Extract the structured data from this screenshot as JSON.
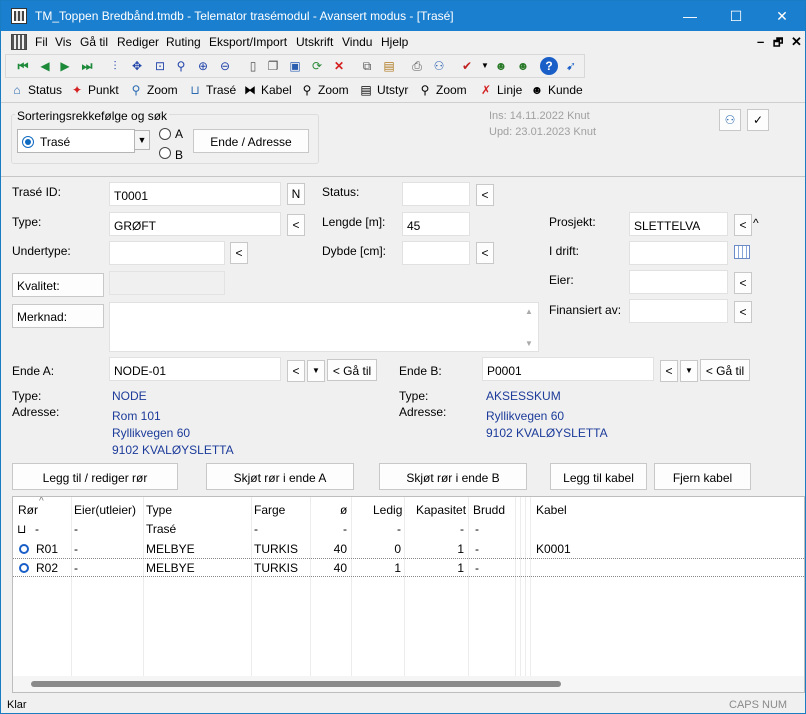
{
  "window": {
    "title": "TM_Toppen Bredbånd.tmdb - Telemator trasémodul - Avansert modus - [Trasé]",
    "min": "—",
    "max": "☐",
    "close": "✕"
  },
  "menu": [
    "Fil",
    "Vis",
    "Gå til",
    "Rediger",
    "Ruting",
    "Eksport/Import",
    "Utskrift",
    "Vindu",
    "Hjelp"
  ],
  "mdi_controls": {
    "min": "–",
    "restore": "🗗",
    "close": "✕"
  },
  "toolbar_icons": [
    "first-record-icon",
    "prev-record-icon",
    "next-record-icon",
    "last-record-icon",
    "route-icon",
    "move-icon",
    "zoom-extent-icon",
    "search-icon",
    "zoom-in-icon",
    "zoom-out-icon",
    "new-icon",
    "copy-icon",
    "save-icon",
    "refresh-icon",
    "delete-icon",
    "copy-record-icon",
    "paste-icon",
    "print-icon",
    "network-icon",
    "map-icon",
    "user-icon",
    "user2-icon",
    "help-icon",
    "context-help-icon"
  ],
  "nav": {
    "status": "Status",
    "punkt": "Punkt",
    "zoom1": "Zoom",
    "trase": "Trasé",
    "kabel": "Kabel",
    "zoom2": "Zoom",
    "utstyr": "Utstyr",
    "zoom3": "Zoom",
    "linje": "Linje",
    "kunde": "Kunde"
  },
  "sort": {
    "group_label": "Sorteringsrekkefølge og søk",
    "selected": "Trasé",
    "radio_a": "A",
    "radio_b": "B",
    "ende_button": "Ende / Adresse"
  },
  "meta": {
    "ins": "Ins: 14.11.2022 Knut",
    "upd": "Upd: 23.01.2023 Knut"
  },
  "form": {
    "trase_id_label": "Trasé ID:",
    "trase_id": "T0001",
    "n_button": "N",
    "type_label": "Type:",
    "type": "GRØFT",
    "undertype_label": "Undertype:",
    "undertype": "",
    "kvalitet_button": "Kvalitet:",
    "kvalitet": "",
    "merknad_button": "Merknad:",
    "merknad": "",
    "status_label": "Status:",
    "status": "",
    "lengde_label": "Lengde [m]:",
    "lengde": "45",
    "dybde_label": "Dybde [cm]:",
    "dybde": "",
    "prosjekt_label": "Prosjekt:",
    "prosjekt": "SLETTELVA",
    "idrift_label": "I drift:",
    "idrift": "",
    "eier_label": "Eier:",
    "eier": "",
    "finansiert_label": "Finansiert av:",
    "finansiert": "",
    "back": "<",
    "up": "^",
    "dropdown": "▼"
  },
  "ende_a": {
    "label": "Ende A:",
    "value": "NODE-01",
    "goto": "< Gå til",
    "type_label": "Type:",
    "type": "NODE",
    "adresse_label": "Adresse:",
    "address_lines": [
      "Rom 101",
      "Ryllikvegen 60",
      "9102 KVALØYSLETTA"
    ]
  },
  "ende_b": {
    "label": "Ende B:",
    "value": "P0001",
    "goto": "< Gå til",
    "type_label": "Type:",
    "type": "AKSESSKUM",
    "adresse_label": "Adresse:",
    "address_lines": [
      "Ryllikvegen 60",
      "9102 KVALØYSLETTA"
    ]
  },
  "actions": {
    "legg_til_ror": "Legg til / rediger rør",
    "skjot_a": "Skjøt rør i ende A",
    "skjot_b": "Skjøt rør i ende B",
    "legg_til_kabel": "Legg til kabel",
    "fjern_kabel": "Fjern kabel"
  },
  "grid": {
    "columns": [
      "Rør",
      "Eier(utleier)",
      "Type",
      "Farge",
      "ø",
      "Ledig",
      "Kapasitet",
      "Brudd",
      "Kabel"
    ],
    "sort_arrow": "^",
    "rows": [
      {
        "ror": "-",
        "eier": "-",
        "type": "Trasé",
        "farge": "-",
        "o": "-",
        "ledig": "-",
        "kapasitet": "-",
        "brudd": "-",
        "kabel": ""
      },
      {
        "ror": "R01",
        "eier": "-",
        "type": "MELBYE",
        "farge": "TURKIS",
        "o": "40",
        "ledig": "0",
        "kapasitet": "1",
        "brudd": "-",
        "kabel": "K0001"
      },
      {
        "ror": "R02",
        "eier": "-",
        "type": "MELBYE",
        "farge": "TURKIS",
        "o": "40",
        "ledig": "1",
        "kapasitet": "1",
        "brudd": "-",
        "kabel": ""
      }
    ]
  },
  "status": {
    "left": "Klar",
    "caps": "CAPS",
    "num": "NUM"
  },
  "colors": {
    "titlebar": "#1b7fcf",
    "link_text": "#1c3b9a",
    "meta_text": "#a0a0a0"
  }
}
